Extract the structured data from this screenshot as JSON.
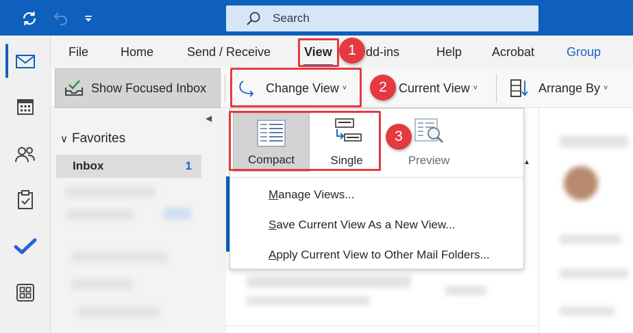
{
  "title_bar": {
    "search_placeholder": "Search",
    "icons": [
      "sync-icon",
      "undo-icon",
      "customize-toolbar-icon"
    ]
  },
  "rail": {
    "items": [
      "mail-icon",
      "calendar-icon",
      "people-icon",
      "tasks-icon",
      "todo-icon",
      "apps-icon"
    ]
  },
  "menu": {
    "tabs": [
      {
        "label": "File"
      },
      {
        "label": "Home"
      },
      {
        "label": "Send / Receive"
      },
      {
        "label": "View",
        "active": true
      },
      {
        "label": "dd-ins"
      },
      {
        "label": "Help"
      },
      {
        "label": "Acrobat"
      },
      {
        "label": "Group"
      }
    ]
  },
  "ribbon": {
    "show_focused_inbox": "Show Focused Inbox",
    "change_view": "Change View",
    "current_view": "Current View",
    "arrange_by": "Arrange By"
  },
  "folders": {
    "favorites": "Favorites",
    "inbox_label": "Inbox",
    "inbox_count": "1"
  },
  "change_view_menu": {
    "options": [
      {
        "label": "Compact",
        "selected": true
      },
      {
        "label": "Single"
      },
      {
        "label": "Preview"
      }
    ],
    "items": [
      {
        "underline": "M",
        "rest": "anage Views..."
      },
      {
        "underline": "S",
        "rest": "ave Current View As a New View..."
      },
      {
        "underline": "A",
        "rest": "pply Current View to Other Mail Folders..."
      }
    ]
  },
  "annotations": [
    "1",
    "2",
    "3"
  ],
  "colors": {
    "accent": "#0f5fbd",
    "highlight": "#e53940",
    "group_tab": "#1a63c4"
  }
}
